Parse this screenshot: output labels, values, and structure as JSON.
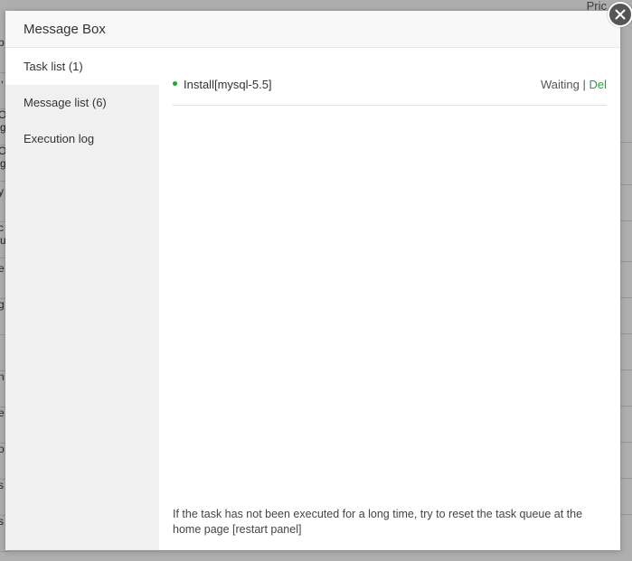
{
  "background": {
    "header_fragment": "Pric",
    "left_fragments": [
      "p",
      "l,",
      "O g",
      "O g",
      "y",
      "c u",
      "e",
      "g",
      "l",
      "n",
      "e",
      "o",
      "s",
      "s"
    ]
  },
  "modal": {
    "title": "Message Box",
    "close_icon": "close-icon",
    "sidebar": {
      "items": [
        {
          "label": "Task list (1)",
          "active": true
        },
        {
          "label": "Message list (6)",
          "active": false
        },
        {
          "label": "Execution log",
          "active": false
        }
      ]
    },
    "tasks": [
      {
        "name": "Install[mysql-5.5]",
        "status": "Waiting",
        "separator": " | ",
        "action": "Del"
      }
    ],
    "note": "If the task has not been executed for a long time, try to reset the task queue at the home page [restart panel]"
  },
  "colors": {
    "accent": "#20a53a",
    "close_bg": "#555555"
  }
}
